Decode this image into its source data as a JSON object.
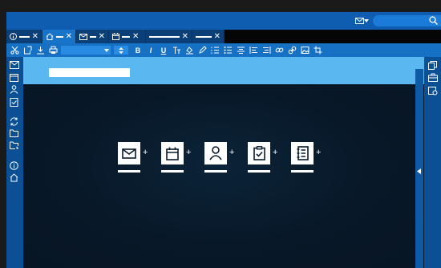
{
  "colors": {
    "topbar": "#0f5db0",
    "tabs": "#0c4f96",
    "active_tab": "#1874c9",
    "toolbar": "#1670c4",
    "rail": "#0b4f95",
    "header": "#5bb7f0",
    "content_bg": "#081828"
  },
  "topbar": {
    "mail_icon": "mail-icon",
    "search_icon": "search-icon"
  },
  "tabs": [
    {
      "icon": "info-icon",
      "active": false
    },
    {
      "icon": "home-icon",
      "active": true
    },
    {
      "icon": "mail-icon",
      "active": false
    },
    {
      "icon": "calendar-icon",
      "active": false
    },
    {
      "icon": null,
      "active": false
    },
    {
      "icon": null,
      "active": false
    }
  ],
  "toolbar": {
    "icons": [
      "cut-icon",
      "new-doc-icon",
      "download-icon",
      "print-icon"
    ],
    "format_buttons": [
      "B",
      "I",
      "U"
    ]
  },
  "launchers": [
    {
      "icon": "mail-icon",
      "plus": "+"
    },
    {
      "icon": "calendar-icon",
      "plus": "+"
    },
    {
      "icon": "contact-icon",
      "plus": "+"
    },
    {
      "icon": "tasks-icon",
      "plus": "+"
    },
    {
      "icon": "notes-icon",
      "plus": "+"
    }
  ],
  "right_panel": {
    "collapse_icon": "chevron-left-icon"
  }
}
